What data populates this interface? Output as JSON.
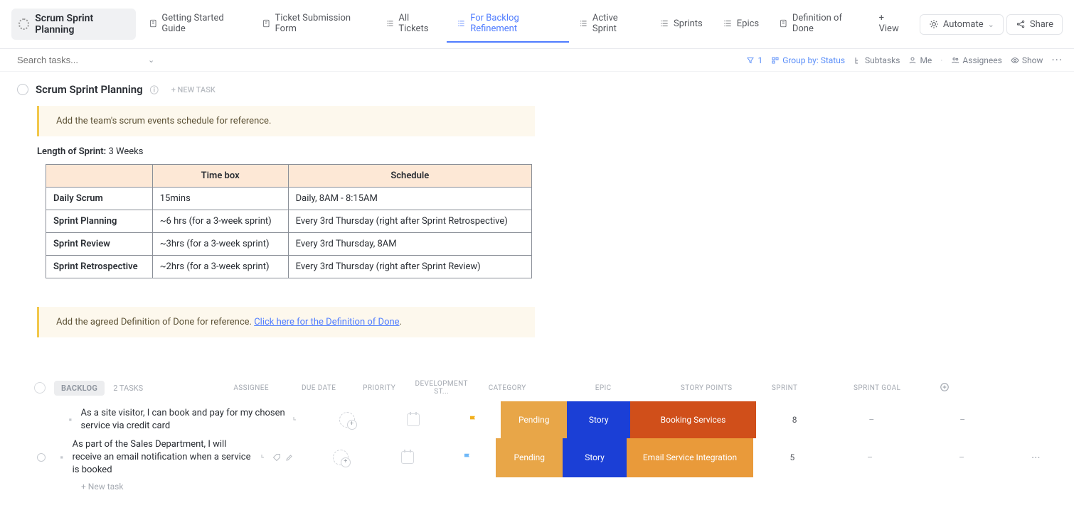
{
  "header": {
    "title": "Scrum Sprint Planning",
    "tabs": [
      {
        "label": "Getting Started Guide"
      },
      {
        "label": "Ticket Submission Form"
      },
      {
        "label": "All Tickets"
      },
      {
        "label": "For Backlog Refinement"
      },
      {
        "label": "Active Sprint"
      },
      {
        "label": "Sprints"
      },
      {
        "label": "Epics"
      },
      {
        "label": "Definition of Done"
      }
    ],
    "add_view": "+ View",
    "automate": "Automate",
    "share": "Share"
  },
  "toolbar": {
    "search_placeholder": "Search tasks...",
    "filter_count": "1",
    "group_by": "Group by: Status",
    "subtasks": "Subtasks",
    "me": "Me",
    "assignees": "Assignees",
    "show": "Show"
  },
  "list": {
    "title": "Scrum Sprint Planning",
    "new_task": "+ NEW TASK",
    "callout1": "Add the team's scrum events schedule for reference.",
    "length_label": "Length of Sprint:",
    "length_value": "3 Weeks",
    "table": {
      "headers": [
        "",
        "Time box",
        "Schedule"
      ],
      "rows": [
        {
          "name": "Daily Scrum",
          "timebox": "15mins",
          "schedule": "Daily, 8AM - 8:15AM"
        },
        {
          "name": "Sprint Planning",
          "timebox": "~6 hrs (for a 3-week sprint)",
          "schedule": "Every 3rd Thursday (right after Sprint Retrospective)"
        },
        {
          "name": "Sprint Review",
          "timebox": "~3hrs (for a 3-week sprint)",
          "schedule": "Every 3rd Thursday, 8AM"
        },
        {
          "name": "Sprint Retrospective",
          "timebox": "~2hrs (for a 3-week sprint)",
          "schedule": "Every 3rd Thursday (right after Sprint Review)"
        }
      ]
    },
    "callout2_text": "Add the agreed Definition of Done for reference. ",
    "callout2_link": "Click here for the Definition of Done",
    "callout2_suffix": "."
  },
  "group": {
    "status": "BACKLOG",
    "count": "2 TASKS",
    "columns": [
      "ASSIGNEE",
      "DUE DATE",
      "PRIORITY",
      "DEVELOPMENT ST...",
      "CATEGORY",
      "EPIC",
      "STORY POINTS",
      "SPRINT",
      "SPRINT GOAL"
    ],
    "tasks": [
      {
        "name": "As a site visitor, I can book and pay for my chosen service via credit card",
        "dev_status": "Pending",
        "dev_color": "#e8a648",
        "category": "Story",
        "cat_color": "#1b3fd6",
        "epic": "Booking Services",
        "epic_color": "#d04f1a",
        "story_points": "8",
        "sprint": "–",
        "goal": "–",
        "flag": "yellow"
      },
      {
        "name": "As part of the Sales Department, I will receive an email notification when a service is booked",
        "dev_status": "Pending",
        "dev_color": "#e8a648",
        "category": "Story",
        "cat_color": "#1b3fd6",
        "epic": "Email Service Integration",
        "epic_color": "#e99a3a",
        "story_points": "5",
        "sprint": "–",
        "goal": "–",
        "flag": "blue"
      }
    ],
    "new_task": "+ New task"
  }
}
